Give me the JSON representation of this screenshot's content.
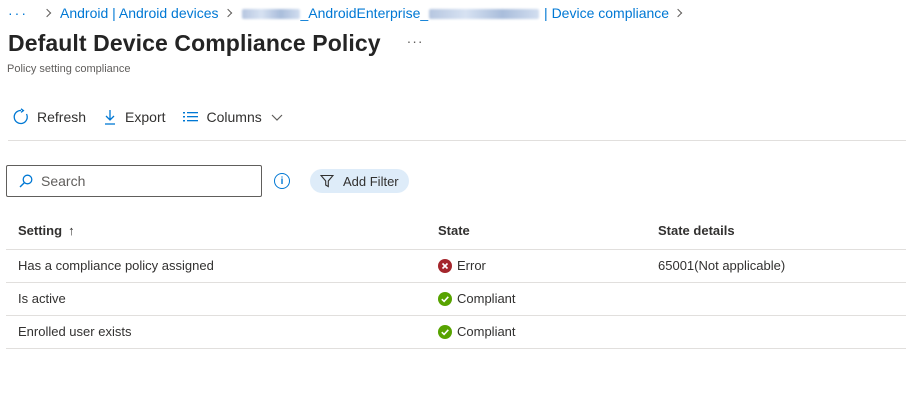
{
  "breadcrumb": {
    "more": "···",
    "items": [
      "Android | Android devices",
      "_AndroidEnterprise_",
      "| Device compliance"
    ]
  },
  "header": {
    "title": "Default Device Compliance Policy",
    "more": "···",
    "subtitle": "Policy setting compliance"
  },
  "toolbar": {
    "refresh_label": "Refresh",
    "export_label": "Export",
    "columns_label": "Columns"
  },
  "search": {
    "placeholder": "Search"
  },
  "filter": {
    "label": "Add Filter"
  },
  "table": {
    "columns": [
      "Setting",
      "State",
      "State details"
    ],
    "sort_indicator": "↑",
    "rows": [
      {
        "setting": "Has a compliance policy assigned",
        "state": "Error",
        "state_icon": "error-icon",
        "details": "65001(Not applicable)"
      },
      {
        "setting": "Is active",
        "state": "Compliant",
        "state_icon": "check-icon",
        "details": ""
      },
      {
        "setting": "Enrolled user exists",
        "state": "Compliant",
        "state_icon": "check-icon",
        "details": ""
      }
    ]
  },
  "colors": {
    "link": "#0078d4",
    "error": "#a4262c",
    "compliant": "#57a300",
    "filter_bg": "#deecf9"
  }
}
